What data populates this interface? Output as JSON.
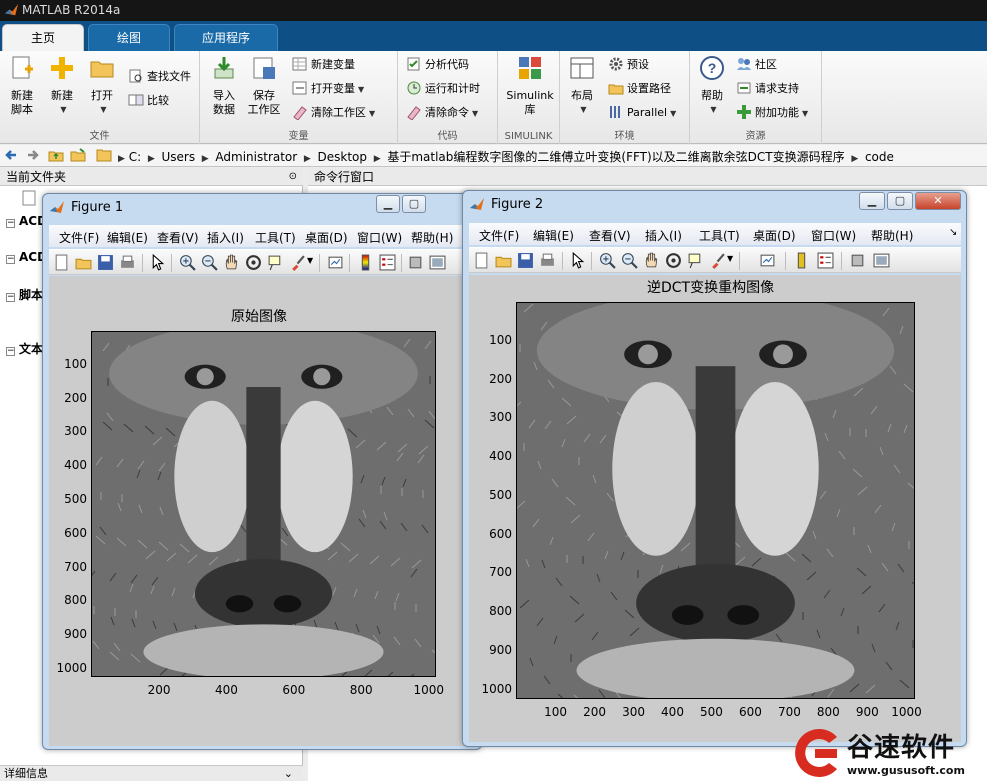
{
  "app": {
    "title": "MATLAB R2014a"
  },
  "tabs": [
    "主页",
    "绘图",
    "应用程序"
  ],
  "ribbon": {
    "file": {
      "label": "文件",
      "new_script": "新建\n脚本",
      "new": "新建",
      "open": "打开",
      "find_files": "查找文件",
      "compare": "比较"
    },
    "variable": {
      "label": "变量",
      "import": "导入\n数据",
      "save": "保存\n工作区",
      "new_var": "新建变量",
      "open_var": "打开变量",
      "clear_ws": "清除工作区"
    },
    "code": {
      "label": "代码",
      "analyze": "分析代码",
      "run_time": "运行和计时",
      "clear_cmd": "清除命令"
    },
    "simulink": {
      "label": "SIMULINK",
      "lib": "Simulink\n库"
    },
    "env": {
      "label": "环境",
      "layout": "布局",
      "prefs": "预设",
      "set_path": "设置路径",
      "parallel": "Parallel"
    },
    "resources": {
      "label": "资源",
      "help": "帮助",
      "community": "社区",
      "support": "请求支持",
      "addons": "附加功能"
    }
  },
  "address": [
    "C:",
    "Users",
    "Administrator",
    "Desktop",
    "基于matlab编程数字图像的二维傅立叶变换(FFT)以及二维离散余弦DCT变换源码程序",
    "code"
  ],
  "panels": {
    "current_folder": "当前文件夹",
    "command_window": "命令行窗口",
    "details": "详细信息",
    "tree": [
      "ACD",
      "ACD",
      "脚本",
      "文本"
    ]
  },
  "figure1": {
    "title": "Figure 1",
    "menu": [
      "文件(F)",
      "编辑(E)",
      "查看(V)",
      "插入(I)",
      "工具(T)",
      "桌面(D)",
      "窗口(W)",
      "帮助(H)"
    ],
    "plot_title": "原始图像",
    "yticks": [
      "100",
      "200",
      "300",
      "400",
      "500",
      "600",
      "700",
      "800",
      "900",
      "1000"
    ],
    "xticks": [
      "200",
      "400",
      "600",
      "800",
      "1000"
    ]
  },
  "figure2": {
    "title": "Figure 2",
    "menu": [
      "文件(F)",
      "编辑(E)",
      "查看(V)",
      "插入(I)",
      "工具(T)",
      "桌面(D)",
      "窗口(W)",
      "帮助(H)"
    ],
    "plot_title": "逆DCT变换重构图像",
    "yticks": [
      "100",
      "200",
      "300",
      "400",
      "500",
      "600",
      "700",
      "800",
      "900",
      "1000"
    ],
    "xticks": [
      "100",
      "200",
      "300",
      "400",
      "500",
      "600",
      "700",
      "800",
      "900",
      "1000"
    ]
  },
  "watermark": {
    "name": "谷速软件",
    "url": "www.gususoft.com"
  }
}
